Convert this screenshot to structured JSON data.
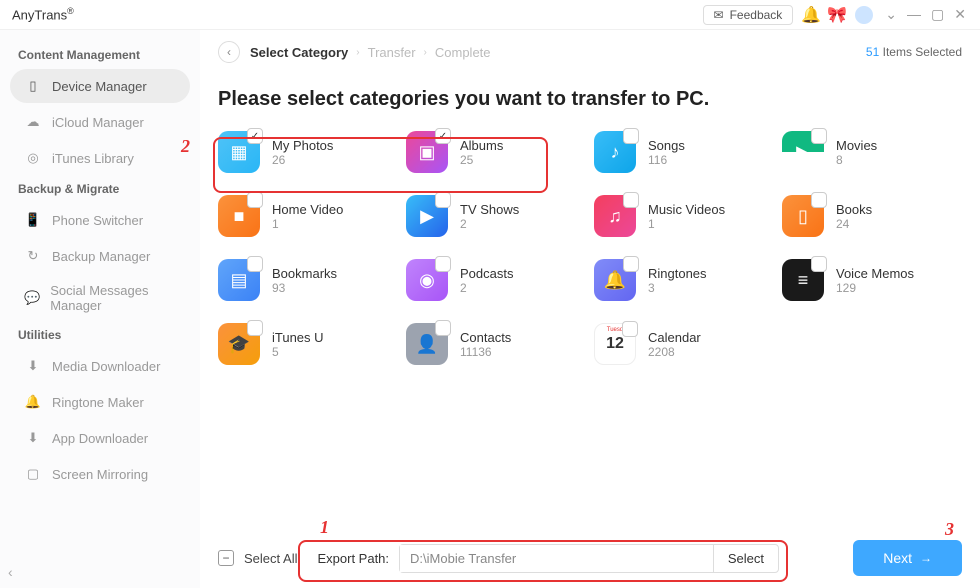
{
  "titlebar": {
    "brand": "AnyTrans",
    "brand_sup": "®",
    "feedback": "Feedback"
  },
  "sidebar": {
    "sections": [
      {
        "title": "Content Management",
        "items": [
          {
            "label": "Device Manager",
            "icon": "device-icon",
            "active": true
          },
          {
            "label": "iCloud Manager",
            "icon": "cloud-icon",
            "active": false
          },
          {
            "label": "iTunes Library",
            "icon": "itunes-icon",
            "active": false
          }
        ]
      },
      {
        "title": "Backup & Migrate",
        "items": [
          {
            "label": "Phone Switcher",
            "icon": "phone-icon",
            "active": false
          },
          {
            "label": "Backup Manager",
            "icon": "backup-icon",
            "active": false
          },
          {
            "label": "Social Messages Manager",
            "icon": "chat-icon",
            "active": false
          }
        ]
      },
      {
        "title": "Utilities",
        "items": [
          {
            "label": "Media Downloader",
            "icon": "download-icon",
            "active": false
          },
          {
            "label": "Ringtone Maker",
            "icon": "bell-icon",
            "active": false
          },
          {
            "label": "App Downloader",
            "icon": "app-icon",
            "active": false
          },
          {
            "label": "Screen Mirroring",
            "icon": "mirror-icon",
            "active": false
          }
        ]
      }
    ]
  },
  "breadcrumbs": {
    "step1": "Select Category",
    "step2": "Transfer",
    "step3": "Complete"
  },
  "selection_summary": {
    "count": "51",
    "label": "Items Selected"
  },
  "heading": "Please select categories you want to transfer to PC.",
  "categories": [
    {
      "name": "My Photos",
      "count": "26",
      "icon_class": "grad-photos",
      "glyph": "▦",
      "checked": true
    },
    {
      "name": "Albums",
      "count": "25",
      "icon_class": "grad-albums",
      "glyph": "▣",
      "checked": true
    },
    {
      "name": "Songs",
      "count": "116",
      "icon_class": "grad-songs",
      "glyph": "♪",
      "checked": false
    },
    {
      "name": "Movies",
      "count": "8",
      "icon_class": "grad-movies",
      "glyph": "▶",
      "checked": false
    },
    {
      "name": "Home Video",
      "count": "1",
      "icon_class": "grad-homevideo",
      "glyph": "■",
      "checked": false
    },
    {
      "name": "TV Shows",
      "count": "2",
      "icon_class": "grad-tvshows",
      "glyph": "▶",
      "checked": false
    },
    {
      "name": "Music Videos",
      "count": "1",
      "icon_class": "grad-musicvideos",
      "glyph": "♫",
      "checked": false
    },
    {
      "name": "Books",
      "count": "24",
      "icon_class": "grad-books",
      "glyph": "▯",
      "checked": false
    },
    {
      "name": "Bookmarks",
      "count": "93",
      "icon_class": "grad-bookmarks",
      "glyph": "▤",
      "checked": false
    },
    {
      "name": "Podcasts",
      "count": "2",
      "icon_class": "grad-podcasts",
      "glyph": "◉",
      "checked": false
    },
    {
      "name": "Ringtones",
      "count": "3",
      "icon_class": "grad-ringtones",
      "glyph": "🔔",
      "checked": false
    },
    {
      "name": "Voice Memos",
      "count": "129",
      "icon_class": "grad-voicememos",
      "glyph": "≡",
      "checked": false
    },
    {
      "name": "iTunes U",
      "count": "5",
      "icon_class": "grad-itunesu",
      "glyph": "🎓",
      "checked": false
    },
    {
      "name": "Contacts",
      "count": "11136",
      "icon_class": "grad-contacts",
      "glyph": "👤",
      "checked": false
    },
    {
      "name": "Calendar",
      "count": "2208",
      "icon_class": "grad-calendar",
      "glyph": "12",
      "checked": false,
      "cal_top": "Tuesd"
    }
  ],
  "bottom": {
    "select_all": "Select All",
    "export_label": "Export Path:",
    "export_value": "D:\\iMobie Transfer",
    "select_btn": "Select",
    "next": "Next"
  },
  "callouts": {
    "c1": "1",
    "c2": "2",
    "c3": "3"
  }
}
